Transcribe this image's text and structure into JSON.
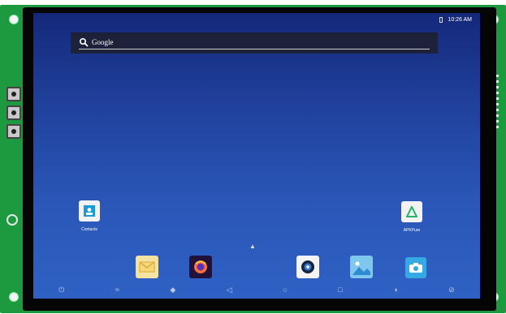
{
  "status_bar": {
    "time": "10:26 AM"
  },
  "search": {
    "label": "Google"
  },
  "apps": [
    {
      "label": "Contacts",
      "icon": "contacts-icon"
    },
    {
      "label": "APKPure",
      "icon": "apkpure-icon"
    }
  ],
  "dock": [
    {
      "icon": "email-icon"
    },
    {
      "icon": "firefox-icon"
    },
    {
      "icon": "camera-lens-icon"
    },
    {
      "icon": "gallery-icon"
    },
    {
      "icon": "camera-icon"
    }
  ],
  "nav_bar": [
    "power-icon",
    "volume-down-icon",
    "volume-up-icon",
    "back-icon",
    "home-icon",
    "recents-icon",
    "screenshot-icon",
    "rotate-icon"
  ],
  "colors": {
    "board": "#1d9a3f",
    "wallpaper_top": "#14287a",
    "wallpaper_bottom": "#2f61c4"
  }
}
